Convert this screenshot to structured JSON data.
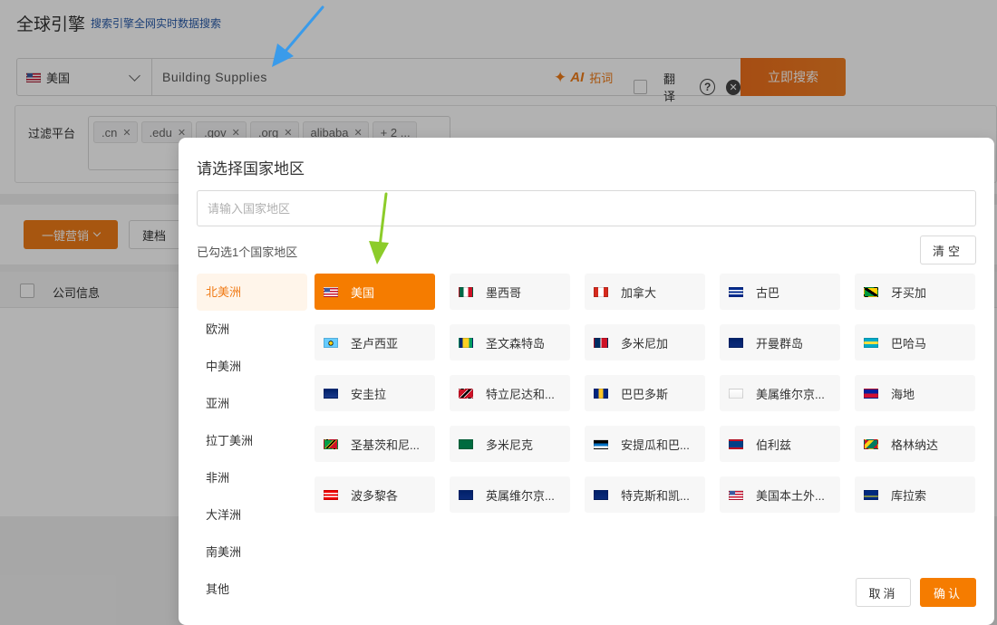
{
  "app": {
    "title": "全球引擎",
    "subtitle": "搜索引擎全网实时数据搜索"
  },
  "search": {
    "country": "美国",
    "query": "Building Supplies",
    "ai_badge": "AI",
    "ai_label": "拓词",
    "translate_label": "翻译",
    "help_symbol": "?",
    "clear_symbol": "✕",
    "submit_label": "立即搜索"
  },
  "filter": {
    "label": "过滤平台",
    "tags": [
      ".cn",
      ".edu",
      ".gov",
      ".org",
      "alibaba"
    ],
    "more": "+ 2 ..."
  },
  "toolbar": {
    "marketing_label": "一键营销",
    "archive_label": "建档"
  },
  "table": {
    "col_company": "公司信息"
  },
  "modal": {
    "title": "请选择国家地区",
    "search_placeholder": "请输入国家地区",
    "selected_count": "已勾选1个国家地区",
    "clear_label": "清空",
    "cancel_label": "取消",
    "confirm_label": "确认",
    "continents": [
      "北美洲",
      "欧洲",
      "中美洲",
      "亚洲",
      "拉丁美洲",
      "非洲",
      "大洋洲",
      "南美洲",
      "其他"
    ],
    "active_continent": "北美洲",
    "countries": [
      {
        "name": "美国",
        "flag": "us",
        "selected": true
      },
      {
        "name": "墨西哥",
        "flag": "mx",
        "selected": false
      },
      {
        "name": "加拿大",
        "flag": "ca",
        "selected": false
      },
      {
        "name": "古巴",
        "flag": "cu",
        "selected": false
      },
      {
        "name": "牙买加",
        "flag": "jm",
        "selected": false
      },
      {
        "name": "圣卢西亚",
        "flag": "lc",
        "selected": false
      },
      {
        "name": "圣文森特岛",
        "flag": "vc",
        "selected": false
      },
      {
        "name": "多米尼加",
        "flag": "do",
        "selected": false
      },
      {
        "name": "开曼群岛",
        "flag": "ky",
        "selected": false
      },
      {
        "name": "巴哈马",
        "flag": "bs",
        "selected": false
      },
      {
        "name": "安圭拉",
        "flag": "ai",
        "selected": false
      },
      {
        "name": "特立尼达和...",
        "flag": "tt",
        "selected": false
      },
      {
        "name": "巴巴多斯",
        "flag": "bb",
        "selected": false
      },
      {
        "name": "美属维尔京...",
        "flag": "vi",
        "selected": false
      },
      {
        "name": "海地",
        "flag": "ht",
        "selected": false
      },
      {
        "name": "圣基茨和尼...",
        "flag": "kn",
        "selected": false
      },
      {
        "name": "多米尼克",
        "flag": "dm",
        "selected": false
      },
      {
        "name": "安提瓜和巴...",
        "flag": "ag",
        "selected": false
      },
      {
        "name": "伯利兹",
        "flag": "bz",
        "selected": false
      },
      {
        "name": "格林纳达",
        "flag": "gd",
        "selected": false
      },
      {
        "name": "波多黎各",
        "flag": "pr",
        "selected": false
      },
      {
        "name": "英属维尔京...",
        "flag": "vg",
        "selected": false
      },
      {
        "name": "特克斯和凯...",
        "flag": "tc",
        "selected": false
      },
      {
        "name": "美国本土外...",
        "flag": "um",
        "selected": false
      },
      {
        "name": "库拉索",
        "flag": "cw",
        "selected": false
      }
    ]
  },
  "colors": {
    "accent": "#f57c00",
    "arrow_blue": "#3a9bea",
    "arrow_green": "#8ccc2a"
  }
}
